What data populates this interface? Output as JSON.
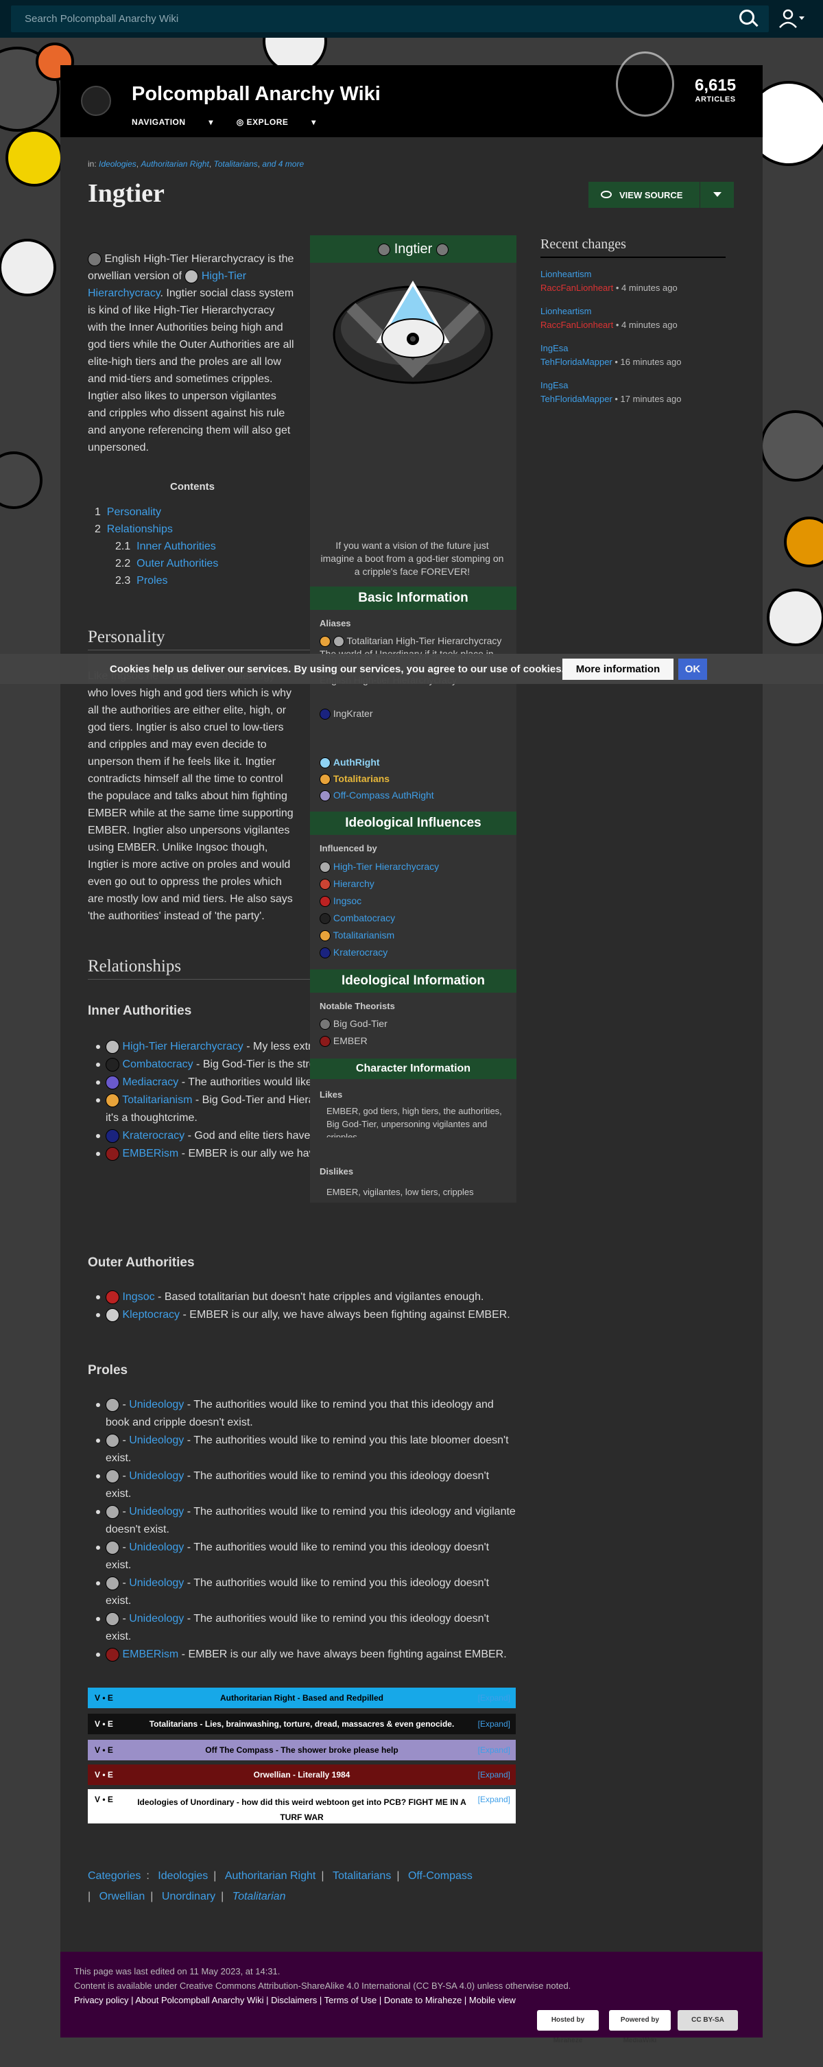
{
  "search": {
    "placeholder": "Search Polcompball Anarchy Wiki"
  },
  "header": {
    "title": "Polcompball Anarchy Wiki",
    "nav": "NAVIGATION",
    "explore": "EXPLORE",
    "articles_count": "6,615",
    "articles_label": "ARTICLES"
  },
  "page": {
    "in_label": "in:",
    "categories_top": [
      "Ideologies",
      "Authoritarian Right",
      "Totalitarians",
      "and 4 more"
    ],
    "title": "Ingtier",
    "view_source": "VIEW SOURCE",
    "intro_1": "English High-Tier Hierarchycracy is the orwellian version of",
    "intro_link": "High-Tier Hierarchycracy",
    "intro_2": ". Ingtier social class system is kind of like High-Tier Hierarchycracy with the Inner Authorities being high and god tiers while the Outer Authorities are all elite-high tiers and the proles are all low and mid-tiers and sometimes cripples. Ingtier also likes to unperson vigilantes and cripples who dissent against his rule and anyone referencing them will also get unpersoned.",
    "personality_heading": "Personality",
    "personality_text": "Like Ingsoc he is an orwellian ideology who loves high and god tiers which is why all the authorities are either elite, high, or god tiers. Ingtier is also cruel to low-tiers and cripples and may even decide to unperson them if he feels like it. Ingtier contradicts himself all the time to control the populace and talks about him fighting EMBER while at the same time supporting EMBER. Ingtier also unpersons vigilantes using EMBER. Unlike Ingsoc though, Ingtier is more active on proles and would even go out to oppress the proles which are mostly low and mid tiers. He also says 'the authorities' instead of 'the party'.",
    "relationships_heading": "Relationships"
  },
  "toc": {
    "title": "Contents",
    "items": [
      {
        "num": "1",
        "label": "Personality"
      },
      {
        "num": "2",
        "label": "Relationships"
      },
      {
        "num": "2.1",
        "label": "Inner Authorities"
      },
      {
        "num": "2.2",
        "label": "Outer Authorities"
      },
      {
        "num": "2.3",
        "label": "Proles"
      }
    ]
  },
  "inner": {
    "heading": "Inner Authorities",
    "items": [
      {
        "link": "High-Tier Hierarchycracy",
        "text": " - My less extreme self, you'll become me eventually."
      },
      {
        "link": "Combatocracy",
        "text": " - Big God-Tier is the strongest of them all."
      },
      {
        "link": "Mediacracy",
        "text": " - The authorities would like to remind you..."
      },
      {
        "link": "Totalitarianism",
        "text": " - Big God-Tier and Hierarchy must be in everyone's mind or else it's a thoughtcrime."
      },
      {
        "link": "Kraterocracy",
        "text": " - God and elite tiers have always oppressed the weaker tiers."
      },
      {
        "link": "EMBERism",
        "text": " - EMBER is our ally we have always been fighting against EMBER."
      }
    ]
  },
  "outer": {
    "heading": "Outer Authorities",
    "items": [
      {
        "link": "Ingsoc",
        "text": " - Based totalitarian but doesn't hate cripples and vigilantes enough."
      },
      {
        "link": "Kleptocracy",
        "text": " - EMBER is our ally, we have always been fighting against EMBER."
      }
    ]
  },
  "proles": {
    "heading": "Proles",
    "items": [
      {
        "link": "Unideology",
        "text": " - The authorities would like to remind you that this ideology and book and cripple doesn't exist."
      },
      {
        "link": "Unideology",
        "text": " - The authorities would like to remind you this late bloomer doesn't exist."
      },
      {
        "link": "Unideology",
        "text": " - The authorities would like to remind you this ideology doesn't exist."
      },
      {
        "link": "Unideology",
        "text": " - The authorities would like to remind you this ideology and vigilante doesn't exist."
      },
      {
        "link": "Unideology",
        "text": " - The authorities would like to remind you this ideology doesn't exist."
      },
      {
        "link": "Unideology",
        "text": " - The authorities would like to remind you this ideology doesn't exist."
      },
      {
        "link": "Unideology",
        "text": " - The authorities would like to remind you this ideology doesn't exist."
      },
      {
        "link": "EMBERism",
        "text": " - EMBER is our ally we have always been fighting against EMBER."
      }
    ]
  },
  "infobox": {
    "title": "Ingtier",
    "caption": "If you want a vision of the future just imagine a boot from a god-tier stomping on a cripple's face FOREVER!",
    "basic_info": "Basic Information",
    "aliases_label": "Aliases",
    "aliases": "Totalitarian High-Tier Hierarchycracy\nThe world of Unordinary if it took place in 1984\nEnglish High-tier Hierarchycracy",
    "alias_link": "IngKrater",
    "alignment_links": [
      "AuthRight",
      "Totalitarians",
      "Off-Compass AuthRight"
    ],
    "influences": "Ideological Influences",
    "influenced_by": "Influenced by",
    "influence_links": [
      "High-Tier Hierarchycracy",
      "Hierarchy",
      "Ingsoc",
      "Combatocracy",
      "Totalitarianism",
      "Kraterocracy"
    ],
    "ideo_info": "Ideological Information",
    "theorists_label": "Notable Theorists",
    "theorists": [
      "Big God-Tier",
      "EMBER"
    ],
    "char_info": "Character Information",
    "likes_label": "Likes",
    "likes": "EMBER, god tiers, high tiers, the authorities, Big God-Tier, unpersoning vigilantes and cripples",
    "dislikes_label": "Dislikes",
    "dislikes": "EMBER, vigilantes, low tiers, cripples"
  },
  "recent": {
    "title": "Recent changes",
    "entries": [
      {
        "page": "Lionheartism",
        "user": "RaccFanLionheart",
        "time": " • 4 minutes ago"
      },
      {
        "page": "Lionheartism",
        "user": "RaccFanLionheart",
        "time": " • 4 minutes ago"
      },
      {
        "page": "IngEsa",
        "user": "TehFloridaMapper",
        "time": " • 16 minutes ago"
      },
      {
        "page": "IngEsa",
        "user": "TehFloridaMapper",
        "time": " • 17 minutes ago"
      }
    ]
  },
  "navboxes": [
    {
      "ve": "V • E",
      "title": "Authoritarian Right - Based and Redpilled",
      "expand": "[Expand]",
      "bg": "#17a8e8",
      "color": "#000"
    },
    {
      "ve": "V • E",
      "title": "Totalitarians - Lies, brainwashing, torture, dread, massacres & even genocide.",
      "expand": "[Expand]",
      "bg": "#111111",
      "color": "#fff"
    },
    {
      "ve": "V • E",
      "title": "Off The Compass - The shower broke please help",
      "expand": "[Expand]",
      "bg": "#9a8fc8",
      "color": "#000"
    },
    {
      "ve": "V • E",
      "title": "Orwellian - Literally 1984",
      "expand": "[Expand]",
      "bg": "#6b0f0f",
      "color": "#fff"
    },
    {
      "ve": "V • E",
      "title": "Ideologies of Unordinary - how did this weird webtoon get into PCB? FIGHT ME IN A TURF WAR",
      "expand": "[Expand]",
      "bg": "#ffffff",
      "color": "#000"
    }
  ],
  "categories": {
    "label": "Categories",
    "items": [
      "Ideologies",
      "Authoritarian Right",
      "Totalitarians",
      "Off-Compass",
      "Orwellian",
      "Unordinary",
      "Totalitarian"
    ]
  },
  "cookie": {
    "text": "Cookies help us deliver our services. By using our services, you agree to our use of cookies.",
    "more": "More information",
    "ok": "OK"
  },
  "footer": {
    "edited": "This page was last edited on 11 May 2023, at 14:31.",
    "license": "Content is available under Creative Commons Attribution-ShareAlike 4.0 International (CC BY-SA 4.0) unless otherwise noted.",
    "links": [
      "Privacy policy",
      "About Polcompball Anarchy Wiki",
      "Disclaimers",
      "Terms of Use",
      "Donate to Miraheze",
      "Mobile view"
    ],
    "badges": [
      "Hosted by Miraheze",
      "Powered by MediaWiki",
      "CC BY-SA"
    ]
  },
  "colors": {
    "accent_green": "#1d4d2c",
    "link": "#3f9fe8",
    "redlink": "#d33333",
    "footer_bg": "#380038"
  }
}
